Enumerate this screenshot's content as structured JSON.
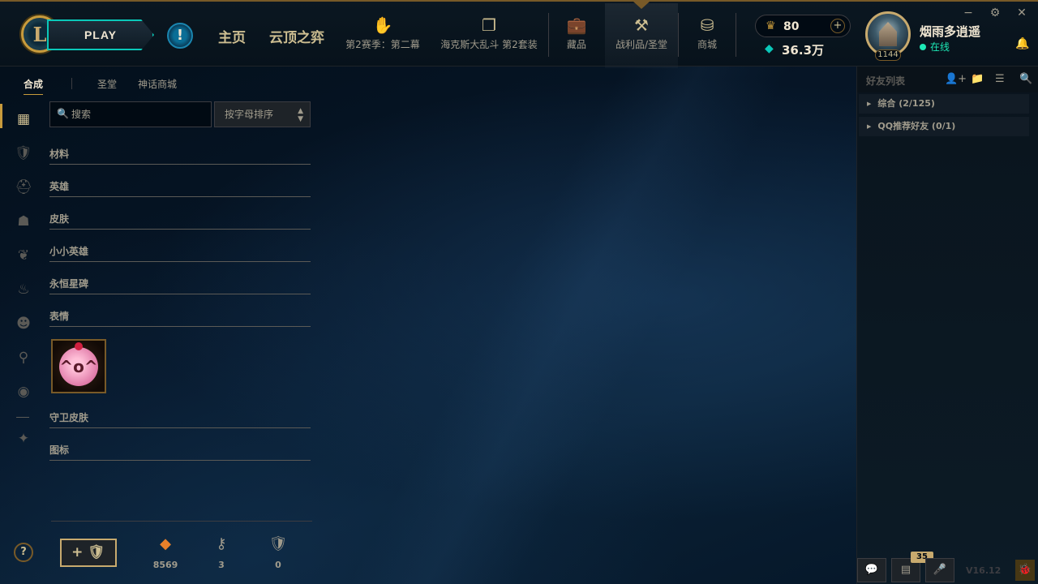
{
  "header": {
    "logo_text": "L",
    "play_label": "PLAY",
    "alert_label": "!",
    "nav_home": "主页",
    "nav_tft": "云顶之弈",
    "nav_season": "第2赛季：第二幕",
    "nav_arena": "海克斯大乱斗 第2套装",
    "nav_collection": "藏品",
    "nav_loot": "战利品/圣堂",
    "nav_store": "商城",
    "rp_value": "80",
    "rp_plus": "+",
    "be_value": "36.3万",
    "username": "烟雨多逍遥",
    "status": "在线",
    "level": "1144",
    "window_controls": [
      "−",
      "⚙",
      "✕"
    ]
  },
  "loot": {
    "tabs": [
      "合成",
      "圣堂",
      "神话商城"
    ],
    "search_placeholder": "搜索",
    "sort_label": "按字母排序",
    "categories": [
      "材料",
      "英雄",
      "皮肤",
      "小小英雄",
      "永恒星碑",
      "表情",
      "守卫皮肤",
      "图标"
    ],
    "emote_face": "^o^",
    "add_chest_label": "+ 🛡",
    "resources": [
      {
        "icon": "orange-essence-icon",
        "glyph": "◆",
        "value": "8569"
      },
      {
        "icon": "key-icon",
        "glyph": "⚷",
        "value": "3"
      },
      {
        "icon": "chest-icon",
        "glyph": "🛡",
        "value": "0"
      }
    ],
    "help_label": "?"
  },
  "social": {
    "title": "好友列表",
    "groups": [
      {
        "label": "综合 (2/125)"
      },
      {
        "label": "QQ推荐好友 (0/1)"
      }
    ],
    "badge_count": "35",
    "version": "V16.12"
  },
  "colors": {
    "gold": "#c89b3c",
    "teal": "#0ac8b9",
    "text": "#a09b8c",
    "background": "#010a13"
  }
}
